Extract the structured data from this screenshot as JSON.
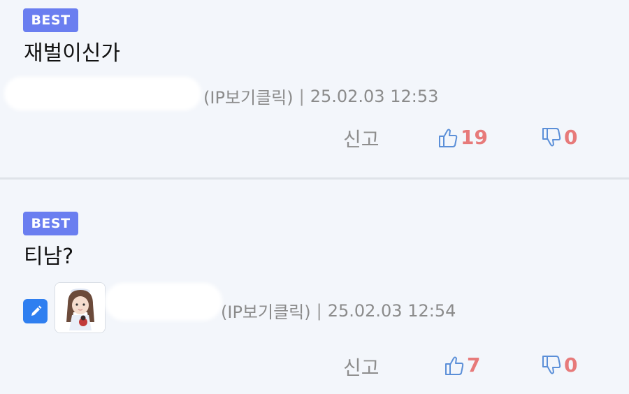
{
  "comments": [
    {
      "badge": "BEST",
      "text": "재벌이신가",
      "ip_label": "(IP보기클릭)",
      "separator": "|",
      "timestamp": "25.02.03 12:53",
      "report_label": "신고",
      "upvotes": "19",
      "downvotes": "0",
      "has_avatar": false
    },
    {
      "badge": "BEST",
      "text": "티남?",
      "ip_label": "(IP보기클릭)",
      "separator": "|",
      "timestamp": "25.02.03 12:54",
      "report_label": "신고",
      "upvotes": "7",
      "downvotes": "0",
      "has_avatar": true
    }
  ],
  "colors": {
    "background": "#f3f6fb",
    "badge": "#6a7ef0",
    "vote_icon": "#5b8fd8",
    "vote_count": "#e77a7a",
    "edit_icon_bg": "#2f7ff0"
  },
  "icons": {
    "upvote": "thumbs-up-icon",
    "downvote": "thumbs-down-icon",
    "edit": "pencil-icon"
  }
}
